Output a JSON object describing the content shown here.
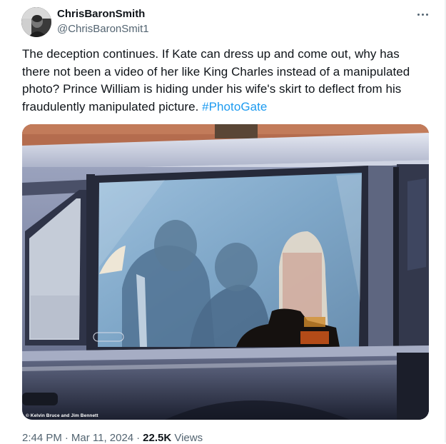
{
  "user": {
    "display_name": "ChrisBaronSmith",
    "handle": "@ChrisBaronSmit1",
    "avatar_icon": "profile-photo"
  },
  "tweet": {
    "text": "The deception continues. If Kate can dress up and come out, why has there not been a video of her like King Charles instead of a manipulated photo? Prince William is hiding under his wife's skirt to deflect from his fraudulently manipulated picture. ",
    "hashtag": "#PhotoGate"
  },
  "media": {
    "credit": "© Kelvin Bruce and Jim Bennett"
  },
  "meta": {
    "time": "2:44 PM",
    "separator": "·",
    "date": "Mar 11, 2024",
    "views_count": "22.5K",
    "views_label": " Views"
  },
  "colors": {
    "link": "#1d9bf0",
    "secondary_text": "#536471",
    "primary_text": "#0f1419"
  }
}
